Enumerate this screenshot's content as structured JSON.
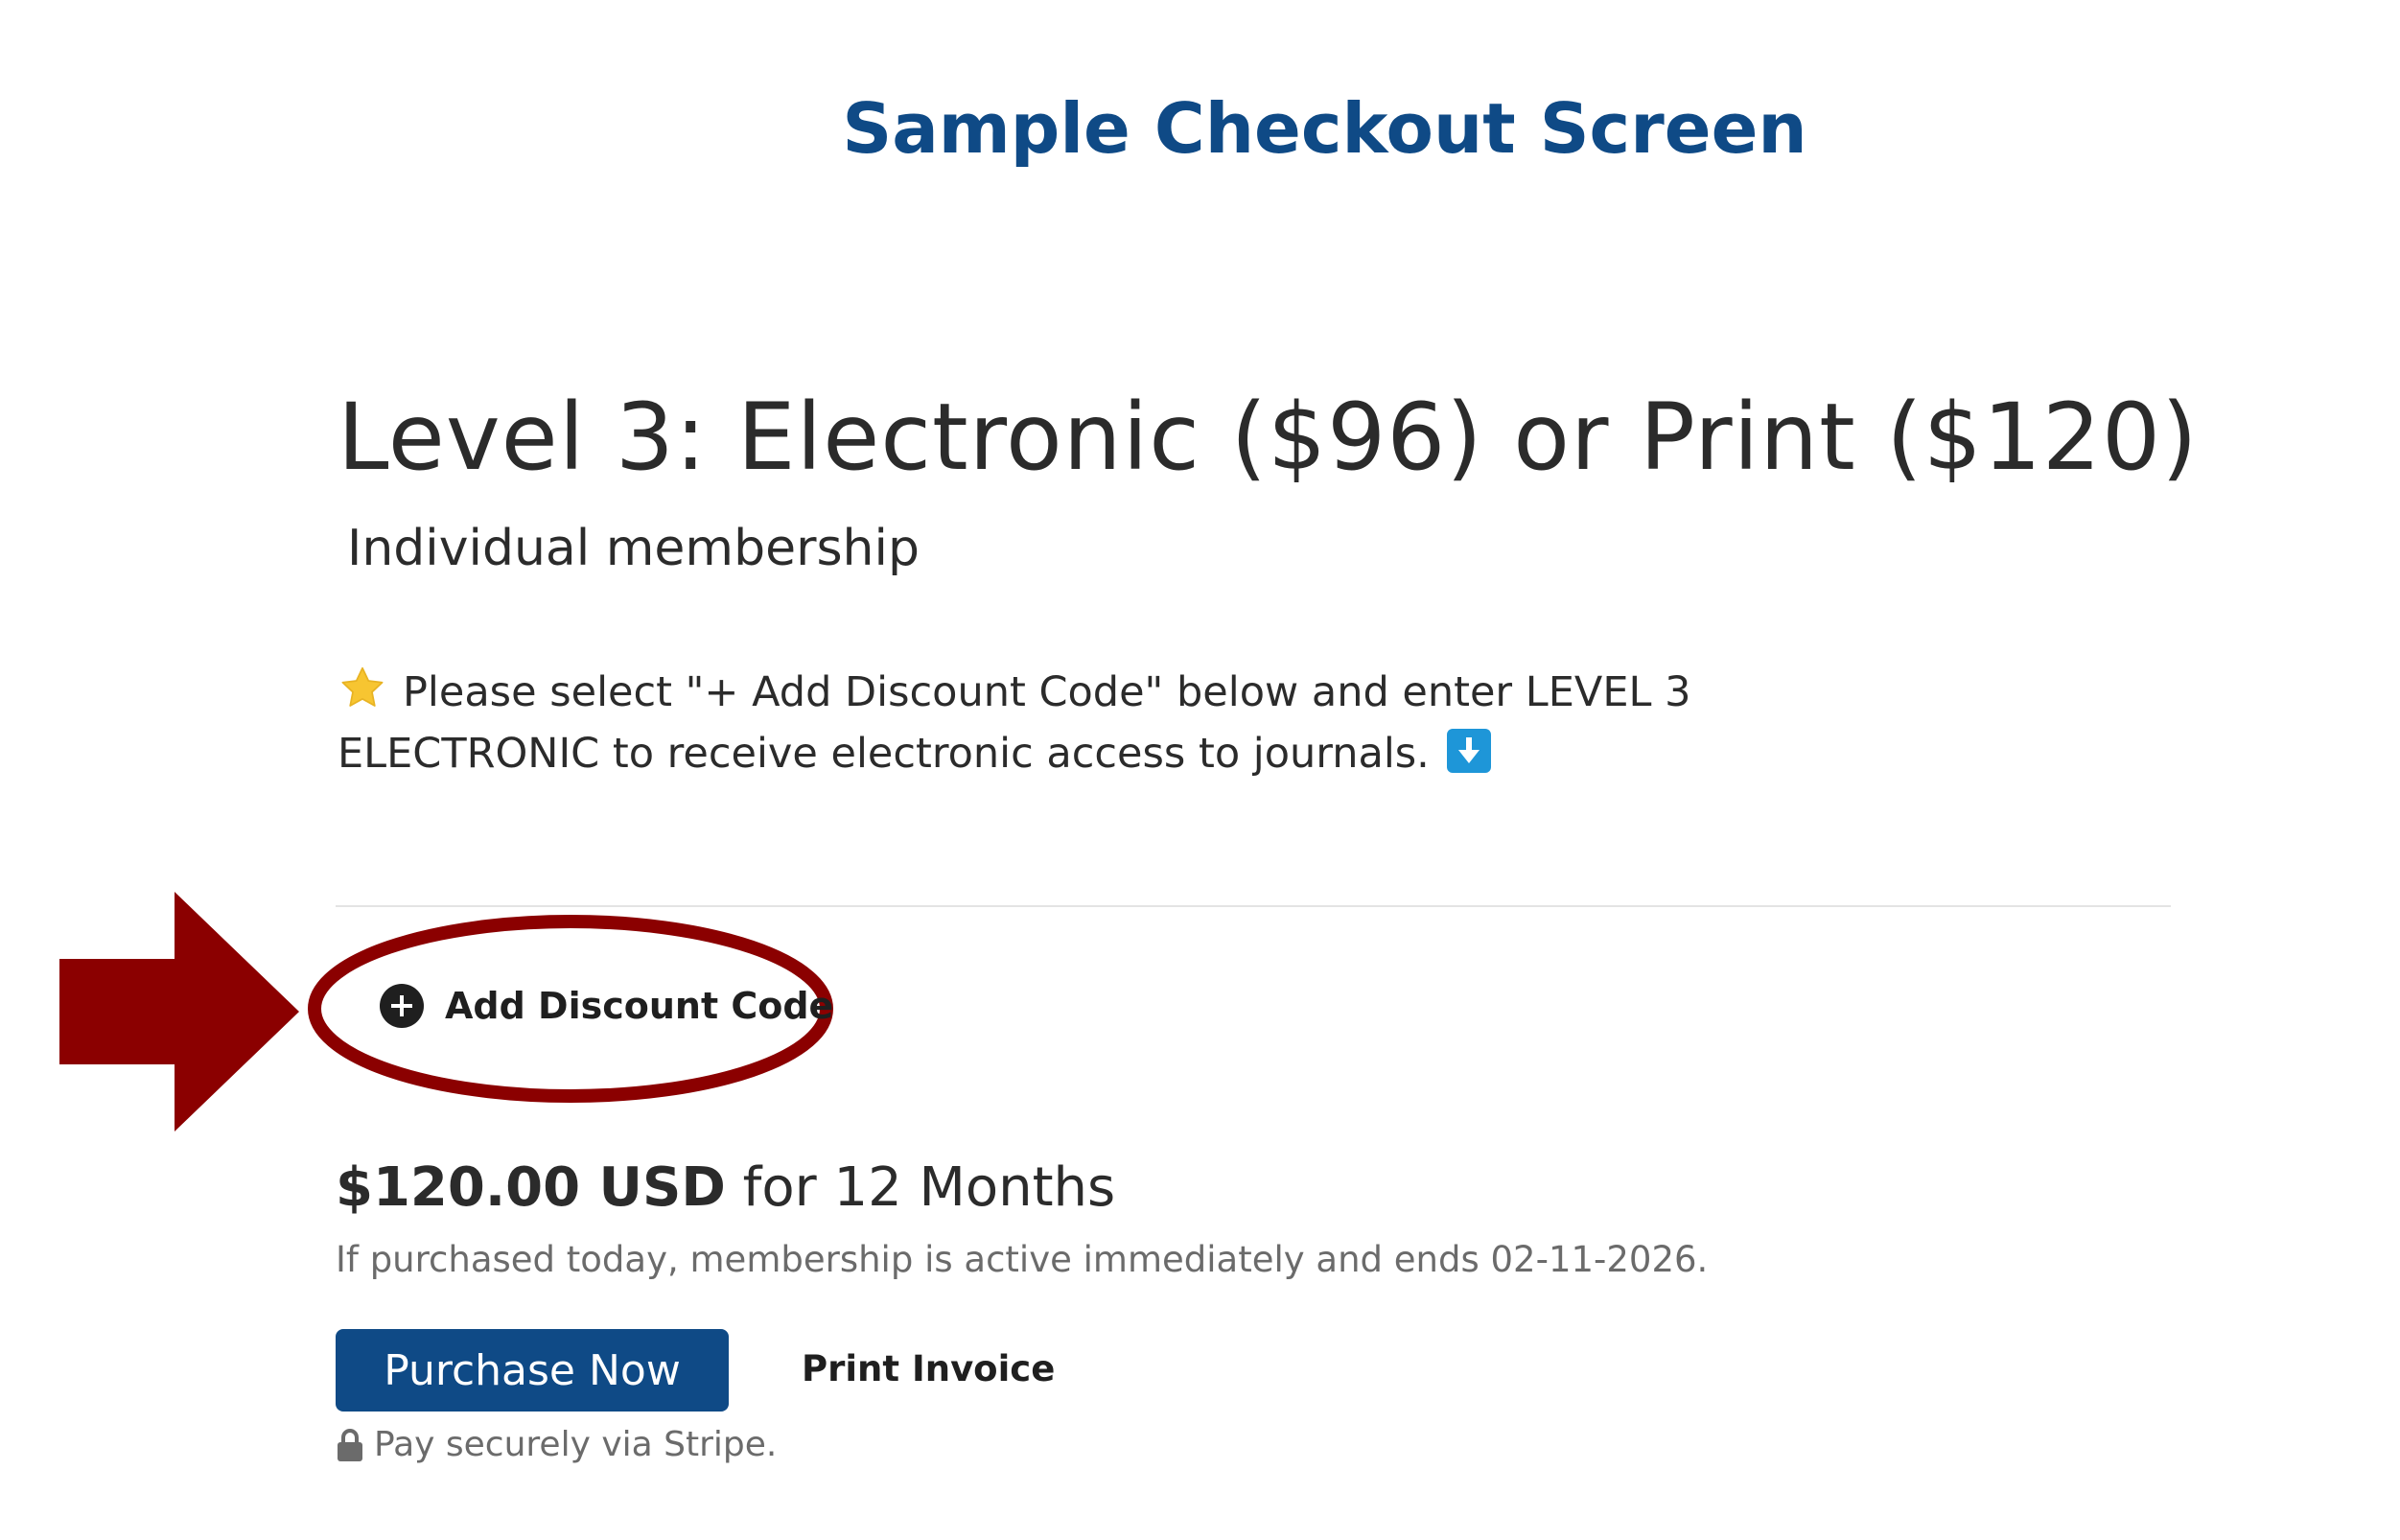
{
  "header": {
    "title": "Sample Checkout Screen"
  },
  "plan": {
    "title": "Level 3: Electronic ($96) or Print ($120)",
    "subtitle": "Individual membership"
  },
  "notice": {
    "line1": "Please select \"+ Add Discount Code\" below and enter LEVEL 3",
    "line2": "ELECTRONIC to receive electronic access to journals.",
    "leading_icon": "star-icon",
    "trailing_icon": "down-arrow-icon"
  },
  "discount": {
    "label": "Add Discount Code",
    "icon": "plus-circle-icon"
  },
  "pricing": {
    "amount": "$120.00 USD",
    "term": "for 12 Months",
    "note": "If purchased today, membership is active immediately and ends 02-11-2026."
  },
  "actions": {
    "purchase_label": "Purchase Now",
    "print_label": "Print Invoice"
  },
  "security": {
    "note": "Pay securely via Stripe.",
    "icon": "lock-icon"
  },
  "colors": {
    "brand_blue": "#0f4a86",
    "annotation_red": "#8b0000",
    "info_blue": "#1e96d8",
    "star_yellow": "#f7c531"
  }
}
